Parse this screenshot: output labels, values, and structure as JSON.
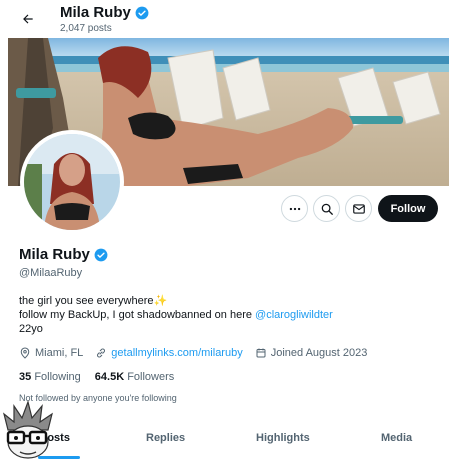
{
  "header": {
    "name": "Mila Ruby",
    "posts": "2,047 posts"
  },
  "actions": {
    "more_icon": "more-dots-icon",
    "search_icon": "search-icon",
    "message_icon": "mail-icon",
    "follow_label": "Follow"
  },
  "profile": {
    "name": "Mila Ruby",
    "handle": "@MilaaRuby",
    "bio_line1": "the girl you see everywhere",
    "bio_line1_emoji": "✨",
    "bio_line2_text": "follow my BackUp, I got shadowbanned on here ",
    "bio_line2_mention": "@clarogliwildter",
    "bio_line3": "22yo",
    "location": "Miami, FL",
    "link": "getallmylinks.com/milaruby",
    "joined": "Joined August 2023"
  },
  "stats": {
    "following_count": "35",
    "following_label": "Following",
    "followers_count": "64.5K",
    "followers_label": "Followers"
  },
  "not_followed_text": "Not followed by anyone you're following",
  "tabs": {
    "posts": "Posts",
    "replies": "Replies",
    "highlights": "Highlights",
    "media": "Media"
  },
  "colors": {
    "accent": "#1d9bf0",
    "text": "#0f1419",
    "muted": "#536471",
    "follow_bg": "#0f1419"
  }
}
